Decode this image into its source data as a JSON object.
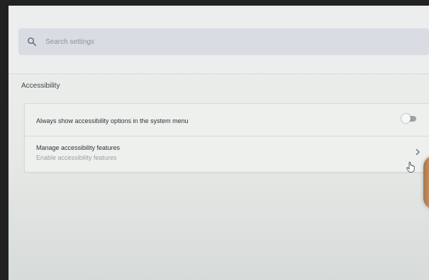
{
  "search": {
    "placeholder": "Search settings",
    "icon": "search-icon"
  },
  "section": {
    "title": "Accessibility"
  },
  "settings": [
    {
      "title": "Always show accessibility options in the system menu",
      "control": "toggle",
      "enabled": false
    },
    {
      "title": "Manage accessibility features",
      "subtitle": "Enable accessibility features",
      "control": "chevron-right-icon"
    }
  ],
  "colors": {
    "background": "#e3e5e2",
    "search_bar": "#d9dde3",
    "toggle_off_track": "#9da2a7",
    "toggle_knob": "#f7f7f7"
  }
}
